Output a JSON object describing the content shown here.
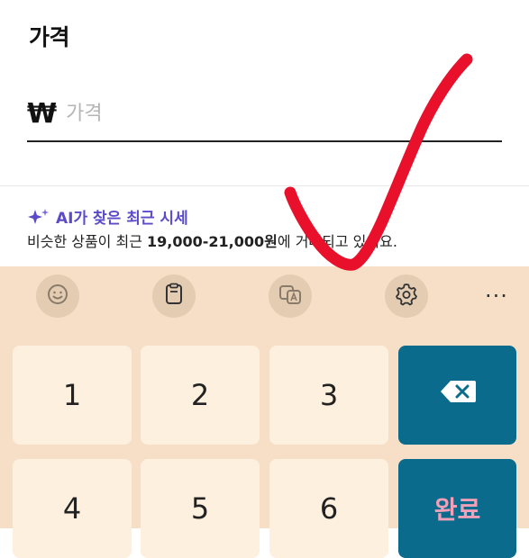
{
  "form": {
    "title": "가격",
    "currency_symbol": "₩",
    "price_placeholder": "가격",
    "price_value": ""
  },
  "ai_hint": {
    "label": "AI가 찾은 최근 시세",
    "description_prefix": "비슷한 상품이 최근 ",
    "price_range": "19,000-21,000원",
    "description_suffix": "에 거래되고 있어요."
  },
  "keyboard": {
    "toolbar": {
      "emoji_icon": "emoji-icon",
      "clipboard_icon": "clipboard-icon",
      "translate_icon": "translate-icon",
      "settings_icon": "gear-icon",
      "more_label": "···"
    },
    "keys": {
      "k1": "1",
      "k2": "2",
      "k3": "3",
      "k4": "4",
      "k5": "5",
      "k6": "6",
      "done": "완료"
    },
    "backspace_icon": "backspace-icon"
  },
  "colors": {
    "accent_ai": "#5b4bc9",
    "keyboard_bg": "#f6dfc6",
    "key_bg": "#fdf0de",
    "action_key_bg": "#0b6b8c",
    "check_mark": "#e8102a"
  }
}
